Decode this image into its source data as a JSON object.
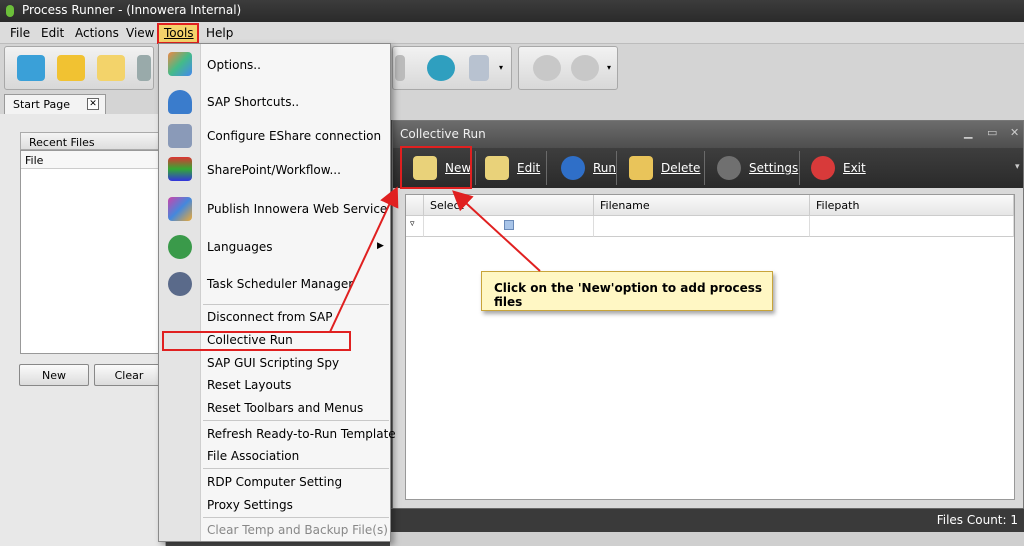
{
  "window": {
    "title": "Process Runner - (Innowera Internal)"
  },
  "menubar": {
    "file": "File",
    "edit": "Edit",
    "actions": "Actions",
    "view": "View",
    "tools": "Tools",
    "help": "Help"
  },
  "tabs": {
    "start_page": "Start Page",
    "close_glyph": "✕"
  },
  "recent_files": {
    "header": "Recent Files",
    "column": "File",
    "new_button": "New",
    "clear_button": "Clear"
  },
  "tools_menu": {
    "items": [
      "Options..",
      "SAP Shortcuts..",
      "Configure EShare connection",
      "SharePoint/Workflow...",
      "Publish Innowera Web Service",
      "Languages",
      "Task Scheduler Manager",
      "Disconnect from SAP",
      "Collective Run",
      "SAP GUI Scripting Spy",
      "Reset Layouts",
      "Reset Toolbars and Menus",
      "Refresh Ready-to-Run Template",
      "File Association",
      "RDP Computer Setting",
      "Proxy Settings",
      "Clear Temp and Backup File(s)"
    ],
    "submenu_arrow": "▶"
  },
  "collective_run": {
    "title": "Collective Run",
    "buttons": {
      "new": "New",
      "edit": "Edit",
      "run": "Run",
      "delete": "Delete",
      "settings": "Settings",
      "exit": "Exit"
    },
    "columns": [
      "Select",
      "Filename",
      "Filepath"
    ]
  },
  "callout": {
    "text": "Click on the 'New'option to add process files"
  },
  "status": {
    "files_count": "Files Count: 1"
  },
  "colors": {
    "highlight": "#e02020",
    "callout_bg": "#fff7c4",
    "dark_bar": "#2a2a2a"
  }
}
